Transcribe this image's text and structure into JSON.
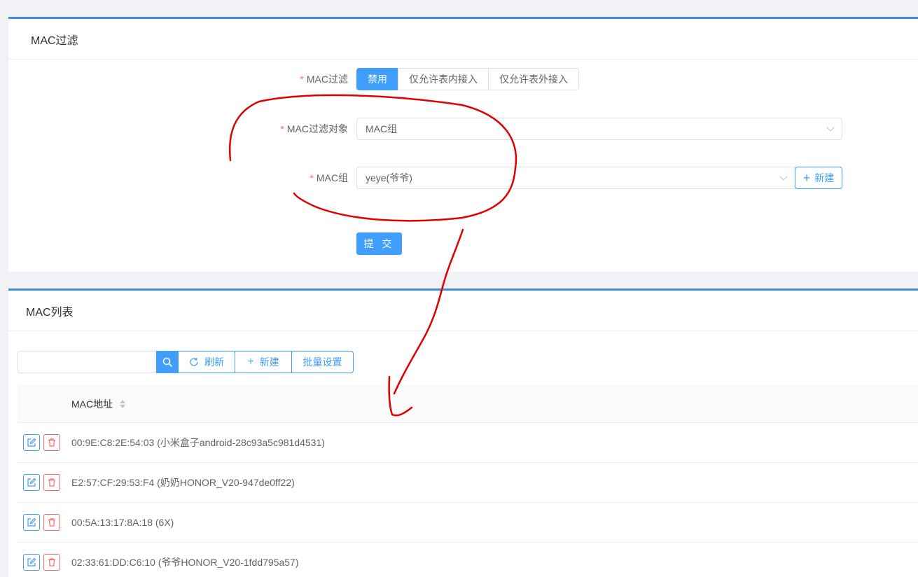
{
  "filter_card": {
    "title": "MAC过滤",
    "filter_label": "MAC过滤",
    "filter_options": [
      "禁用",
      "仅允许表内接入",
      "仅允许表外接入"
    ],
    "target_label": "MAC过滤对象",
    "target_value": "MAC组",
    "group_label": "MAC组",
    "group_value": "yeye(爷爷)",
    "new_button": "新建",
    "submit_button": "提 交"
  },
  "list_card": {
    "title": "MAC列表",
    "search_placeholder": "",
    "refresh_button": "刷新",
    "new_button": "新建",
    "batch_button": "批量设置",
    "column_header": "MAC地址",
    "rows": [
      "00:9E:C8:2E:54:03 (小米盒子android-28c93a5c981d4531)",
      "E2:57:CF:29:53:F4 (奶奶HONOR_V20-947de0ff22)",
      "00:5A:13:17:8A:18 (6X)",
      "02:33:61:DD:C6:10 (爷爷HONOR_V20-1fdd795a57)"
    ]
  },
  "colors": {
    "primary": "#409eff",
    "danger": "#f56c6c",
    "annotation": "#e00000"
  }
}
